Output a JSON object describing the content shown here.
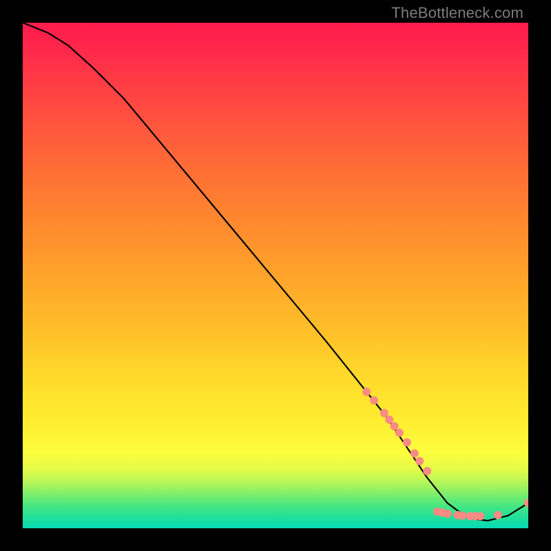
{
  "watermark": "TheBottleneck.com",
  "chart_data": {
    "type": "line",
    "title": "",
    "xlabel": "",
    "ylabel": "",
    "xlim": [
      0,
      100
    ],
    "ylim": [
      0,
      100
    ],
    "grid": false,
    "series": [
      {
        "name": "curve",
        "x": [
          0,
          5,
          9,
          14,
          20,
          30,
          40,
          50,
          60,
          68,
          72,
          76,
          80,
          84,
          88,
          92,
          96,
          100
        ],
        "y": [
          100,
          98,
          95.5,
          91,
          85,
          73,
          61,
          49,
          37,
          27,
          22,
          16,
          10,
          5,
          2,
          1.5,
          2.5,
          5
        ]
      }
    ],
    "markers": {
      "name": "highlight-points",
      "color": "#f88b83",
      "radius": 6,
      "points": [
        {
          "x": 68,
          "y": 27
        },
        {
          "x": 69.5,
          "y": 25.3
        },
        {
          "x": 71.5,
          "y": 22.8
        },
        {
          "x": 72.5,
          "y": 21.5
        },
        {
          "x": 73.5,
          "y": 20.2
        },
        {
          "x": 74.5,
          "y": 18.9
        },
        {
          "x": 76,
          "y": 17
        },
        {
          "x": 77.5,
          "y": 14.8
        },
        {
          "x": 78.5,
          "y": 13.3
        },
        {
          "x": 80,
          "y": 11.3
        },
        {
          "x": 82,
          "y": 3.3
        },
        {
          "x": 83,
          "y": 3.1
        },
        {
          "x": 84,
          "y": 2.9
        },
        {
          "x": 86,
          "y": 2.6
        },
        {
          "x": 87,
          "y": 2.5
        },
        {
          "x": 88.5,
          "y": 2.4
        },
        {
          "x": 89.5,
          "y": 2.4
        },
        {
          "x": 90.5,
          "y": 2.4
        },
        {
          "x": 94,
          "y": 2.6
        },
        {
          "x": 100,
          "y": 5
        }
      ]
    }
  }
}
